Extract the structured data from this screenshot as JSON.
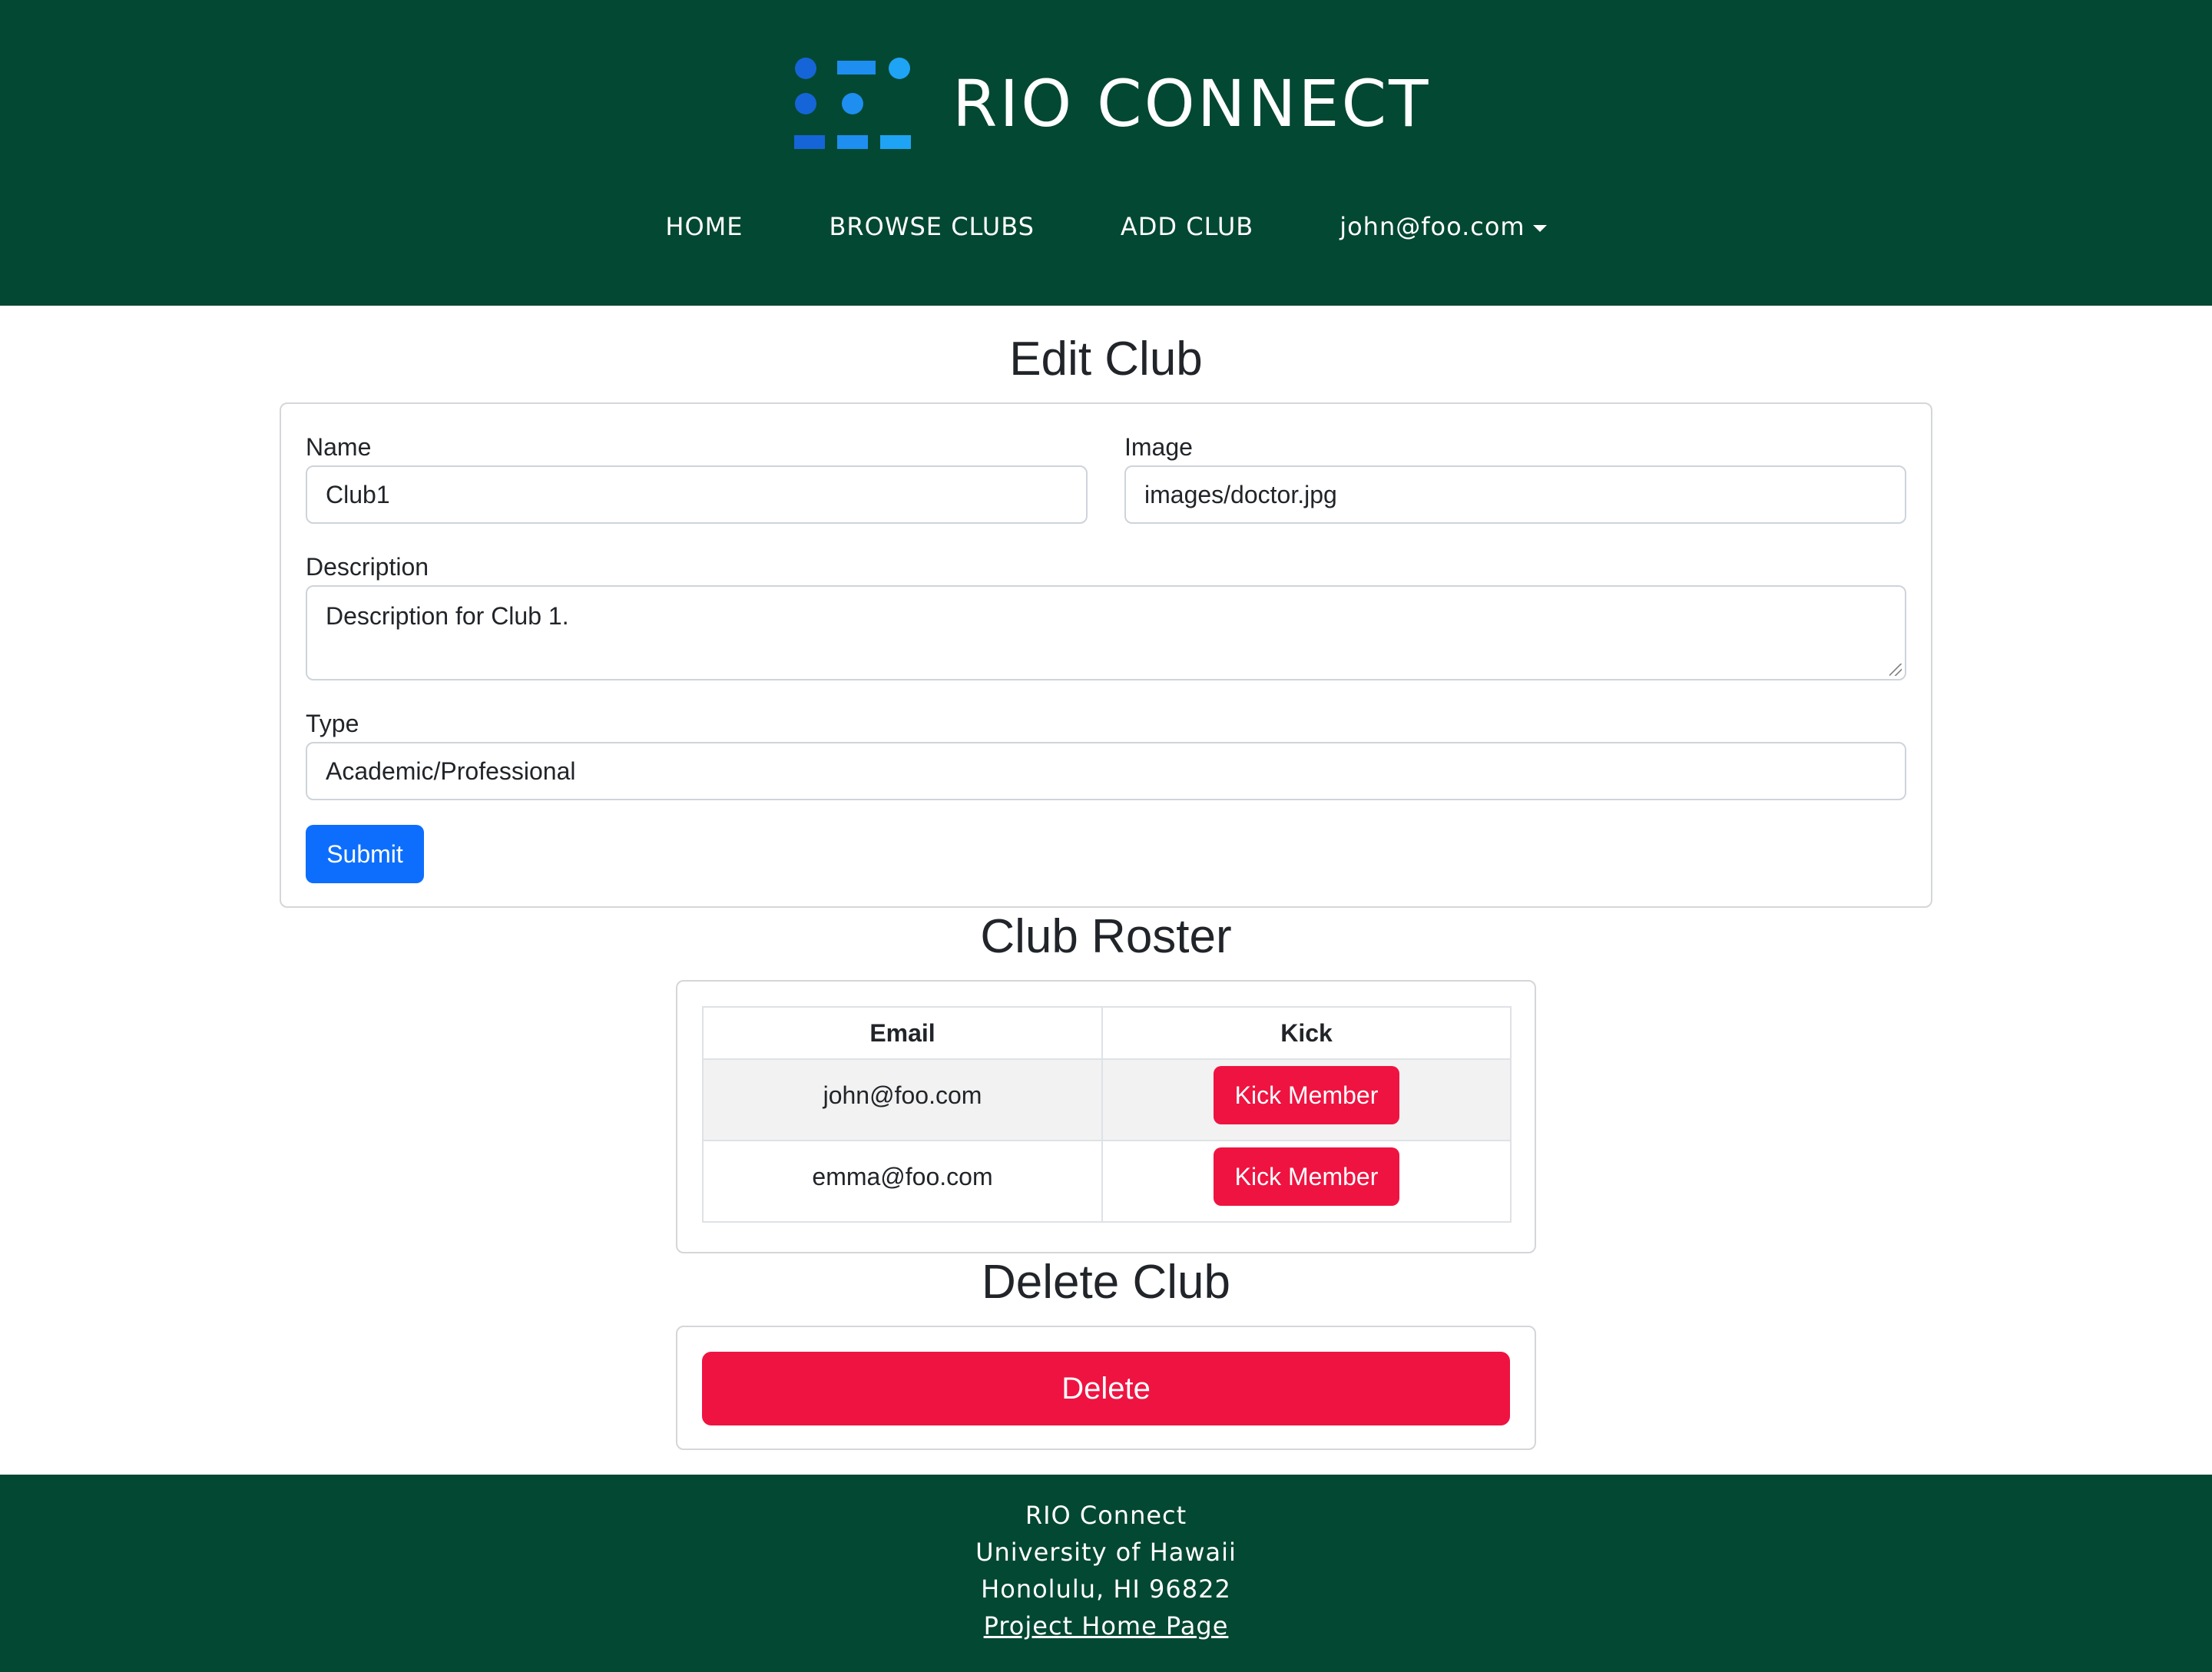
{
  "header": {
    "brand_title": "RIO CONNECT",
    "nav": {
      "home": "HOME",
      "browse": "BROWSE CLUBS",
      "add": "ADD CLUB",
      "user": "john@foo.com"
    },
    "logo_colors": [
      "#1565d8",
      "#1e8ef0",
      "#1fa3f5"
    ]
  },
  "edit": {
    "title": "Edit Club",
    "name_label": "Name",
    "name_value": "Club1",
    "image_label": "Image",
    "image_value": "images/doctor.jpg",
    "description_label": "Description",
    "description_value": "Description for Club 1.",
    "type_label": "Type",
    "type_value": "Academic/Professional",
    "submit_label": "Submit"
  },
  "roster": {
    "title": "Club Roster",
    "columns": [
      "Email",
      "Kick"
    ],
    "rows": [
      {
        "email": "john@foo.com",
        "action": "Kick Member"
      },
      {
        "email": "emma@foo.com",
        "action": "Kick Member"
      }
    ]
  },
  "delete": {
    "title": "Delete Club",
    "button_label": "Delete"
  },
  "footer": {
    "line1": "RIO Connect",
    "line2": "University of Hawaii",
    "line3": "Honolulu, HI 96822",
    "link": "Project Home Page"
  },
  "colors": {
    "header_bg": "#034832",
    "primary": "#0d6efd",
    "danger": "#ef1341"
  }
}
